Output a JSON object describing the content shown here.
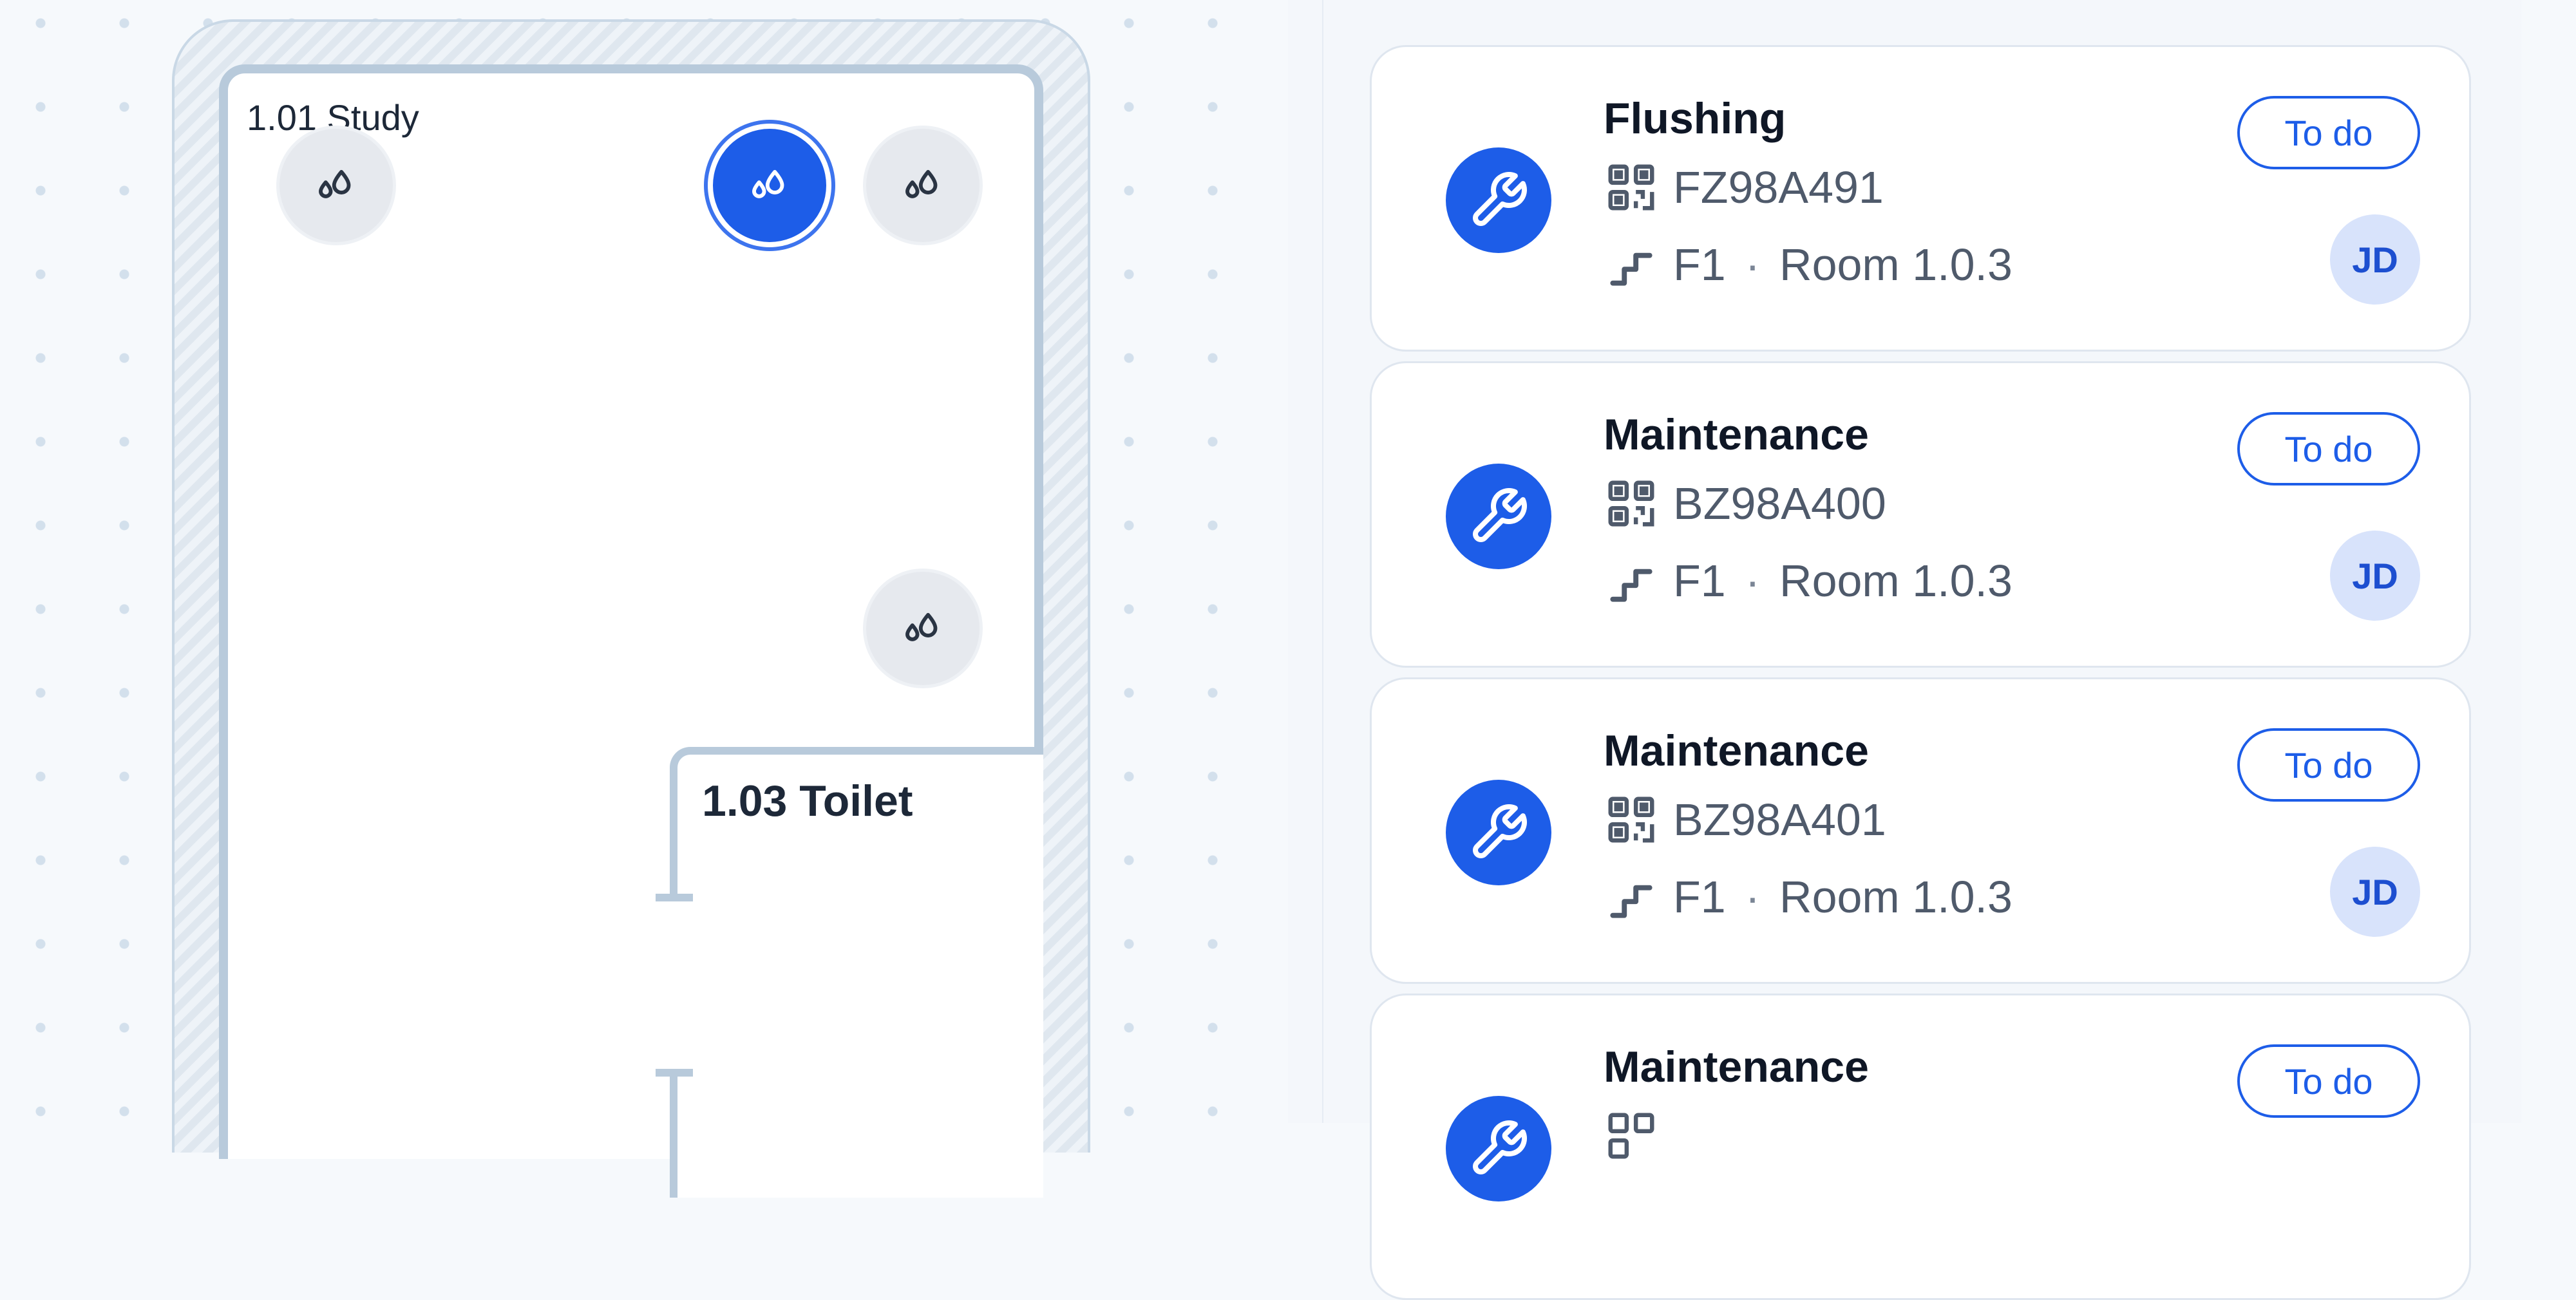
{
  "floor_plan": {
    "rooms": [
      {
        "label": "1.01 Study"
      },
      {
        "label": "1.03 Toilet"
      }
    ],
    "sensors": [
      {
        "icon": "water-drops-icon",
        "state": "idle"
      },
      {
        "icon": "water-drops-icon",
        "state": "selected"
      },
      {
        "icon": "water-drops-icon",
        "state": "idle"
      },
      {
        "icon": "water-drops-icon",
        "state": "idle"
      }
    ]
  },
  "tasks": [
    {
      "title": "Flushing",
      "code": "FZ98A491",
      "floor": "F1",
      "separator": "·",
      "room": "Room 1.0.3",
      "status": "To do",
      "assignee": "JD",
      "icon": "wrench-icon"
    },
    {
      "title": "Maintenance",
      "code": "BZ98A400",
      "floor": "F1",
      "separator": "·",
      "room": "Room 1.0.3",
      "status": "To do",
      "assignee": "JD",
      "icon": "wrench-icon"
    },
    {
      "title": "Maintenance",
      "code": "BZ98A401",
      "floor": "F1",
      "separator": "·",
      "room": "Room 1.0.3",
      "status": "To do",
      "assignee": "JD",
      "icon": "wrench-icon"
    },
    {
      "title": "Maintenance",
      "status": "To do",
      "icon": "wrench-icon"
    }
  ],
  "colors": {
    "accent": "#1d5de8",
    "wall": "#b8cadb",
    "avatar_bg": "#d8e3fb"
  }
}
